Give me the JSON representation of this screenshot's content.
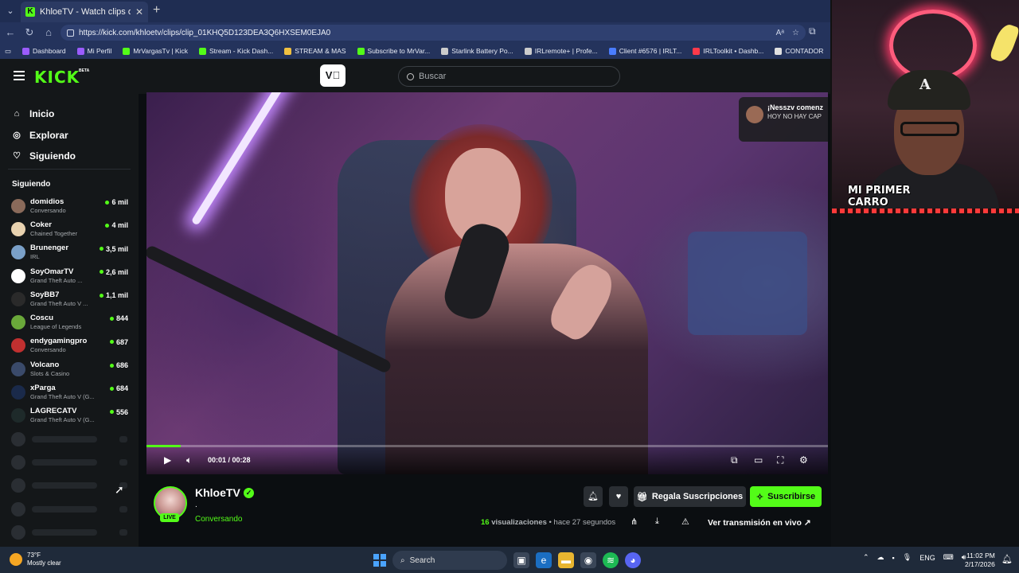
{
  "browser": {
    "tab_title": "KhloeTV - Watch clips on Kick",
    "url": "https://kick.com/khloetv/clips/clip_01KHQ5D123DEA3Q6HXSEM0EJA0",
    "bookmarks": [
      {
        "label": "Dashboard",
        "color": "#9b5cff"
      },
      {
        "label": "Mi Perfil",
        "color": "#9b5cff"
      },
      {
        "label": "MrVargasTv | Kick",
        "color": "#53fc18"
      },
      {
        "label": "Stream - Kick Dash...",
        "color": "#53fc18"
      },
      {
        "label": "STREAM & MAS",
        "color": "#f0c040"
      },
      {
        "label": "Subscribe to MrVar...",
        "color": "#53fc18"
      },
      {
        "label": "Starlink Battery Po...",
        "color": "#cccccc"
      },
      {
        "label": "IRLremote+ | Profe...",
        "color": "#cccccc"
      },
      {
        "label": "Client #6576 | IRLT...",
        "color": "#4a7dff"
      },
      {
        "label": "IRLToolkit • Dashb...",
        "color": "#ff3a4a"
      },
      {
        "label": "CONTADOR",
        "color": "#e0e0e0"
      }
    ]
  },
  "kick": {
    "logo": "KICK",
    "beta": "BETA",
    "clip_button_icon": "clip-icon",
    "search_placeholder": "Buscar",
    "nav": [
      {
        "label": "Inicio",
        "icon": "home-icon",
        "glyph": "⌂"
      },
      {
        "label": "Explorar",
        "icon": "compass-icon",
        "glyph": "◎"
      },
      {
        "label": "Siguiendo",
        "icon": "heart-icon",
        "glyph": "♡"
      }
    ],
    "following_heading": "Siguiendo",
    "channels": [
      {
        "name": "domidios",
        "category": "Conversando",
        "viewers": "6 mil",
        "color": "#8a6a5a"
      },
      {
        "name": "Coker",
        "category": "Chained Together",
        "viewers": "4 mil",
        "color": "#e8d2b0"
      },
      {
        "name": "Brunenger",
        "category": "IRL",
        "viewers": "3,5 mil",
        "color": "#7aa0c8"
      },
      {
        "name": "SoyOmarTV",
        "category": "Grand Theft Auto ...",
        "viewers": "2,6 mil",
        "color": "#ffffff"
      },
      {
        "name": "SoyBB7",
        "category": "Grand Theft Auto V ...",
        "viewers": "1,1 mil",
        "color": "#2a2a2a"
      },
      {
        "name": "Coscu",
        "category": "League of Legends",
        "viewers": "844",
        "color": "#6aa83a"
      },
      {
        "name": "endygamingpro",
        "category": "Conversando",
        "viewers": "687",
        "color": "#c03030"
      },
      {
        "name": "Volcano",
        "category": "Slots & Casino",
        "viewers": "686",
        "color": "#3a4a6a"
      },
      {
        "name": "xParga",
        "category": "Grand Theft Auto V (G...",
        "viewers": "684",
        "color": "#1a2a4a"
      },
      {
        "name": "LAGRECATV",
        "category": "Grand Theft Auto V (G...",
        "viewers": "556",
        "color": "#1e2a2a"
      }
    ],
    "skeleton_rows": 5
  },
  "video": {
    "notification_title": "¡Nesszv comenz",
    "notification_sub": "HOY NO HAY CAP",
    "time_current": "00:01",
    "time_total": "00:28",
    "progress": 0.05
  },
  "clip_info": {
    "streamer": "KhloeTV",
    "live_badge": "LIVE",
    "dot_line": ".",
    "category": "Conversando",
    "gift_label": "Regala Suscripciones",
    "subscribe_label": "Suscribirse",
    "views_count": "16",
    "views_label": "visualizaciones",
    "time_ago": "hace 27 segundos",
    "watch_live_label": "Ver transmisión en vivo"
  },
  "webcam": {
    "overlay_text_1": "MI PRIMER",
    "overlay_text_2": "CARRO"
  },
  "taskbar": {
    "temperature": "73°F",
    "weather": "Mostly clear",
    "search_label": "Search",
    "language": "ENG",
    "time": "11:02 PM",
    "date": "2/17/2026"
  }
}
